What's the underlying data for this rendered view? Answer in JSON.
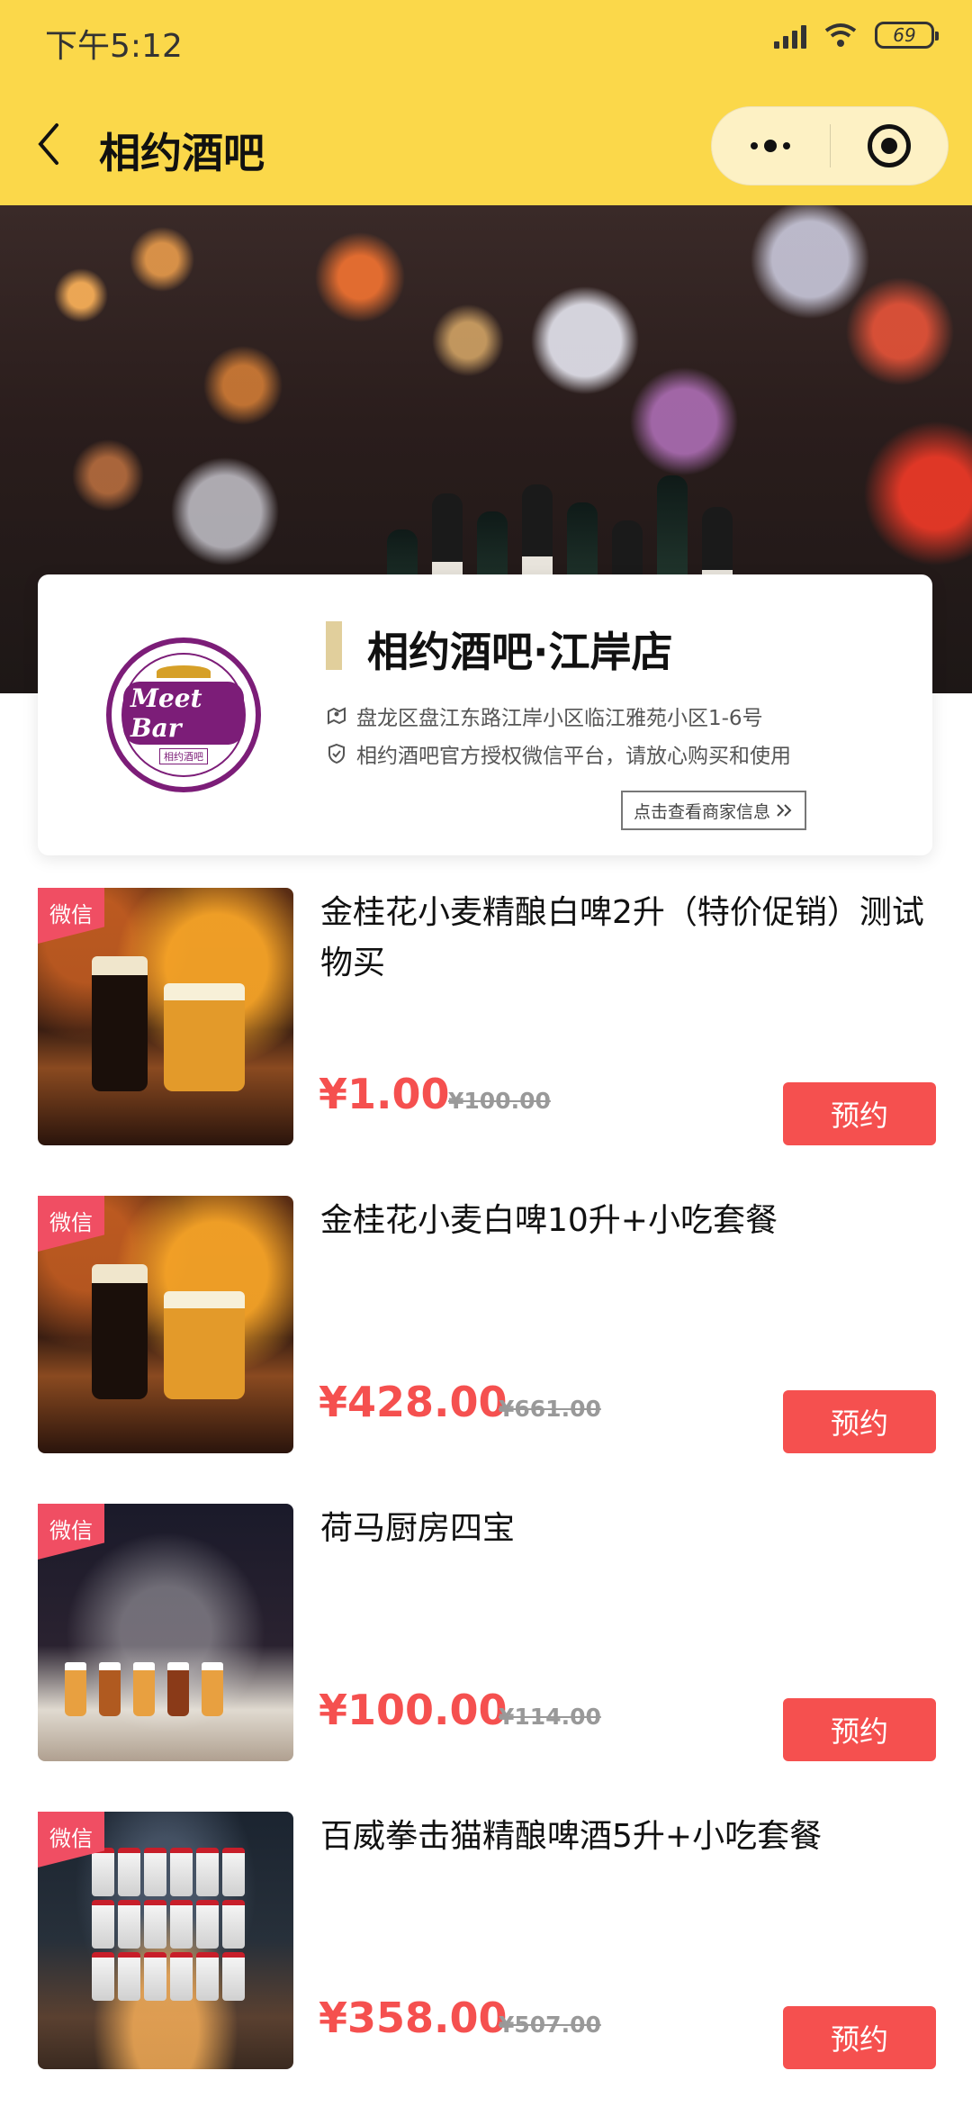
{
  "status_bar": {
    "time": "下午5:12",
    "battery": "69"
  },
  "nav": {
    "title": "相约酒吧"
  },
  "shop": {
    "logo_text": "Meet Bar",
    "logo_sub": "相约酒吧",
    "name": "相约酒吧·江岸店",
    "address": "盘龙区盘江东路江岸小区临江雅苑小区1-6号",
    "authorization": "相约酒吧官方授权微信平台，请放心购买和使用",
    "merchant_button": "点击查看商家信息"
  },
  "products": [
    {
      "badge": "微信",
      "title": "金桂花小麦精酿白啤2升（特价促销）测试物买",
      "price": "¥1.00",
      "original_price": "¥100.00",
      "button": "预约"
    },
    {
      "badge": "微信",
      "title": "金桂花小麦白啤10升+小吃套餐",
      "price": "¥428.00",
      "original_price": "¥661.00",
      "button": "预约"
    },
    {
      "badge": "微信",
      "title": "荷马厨房四宝",
      "price": "¥100.00",
      "original_price": "¥114.00",
      "button": "预约"
    },
    {
      "badge": "微信",
      "title": "百威拳击猫精酿啤酒5升+小吃套餐",
      "price": "¥358.00",
      "original_price": "¥507.00",
      "button": "预约"
    }
  ]
}
